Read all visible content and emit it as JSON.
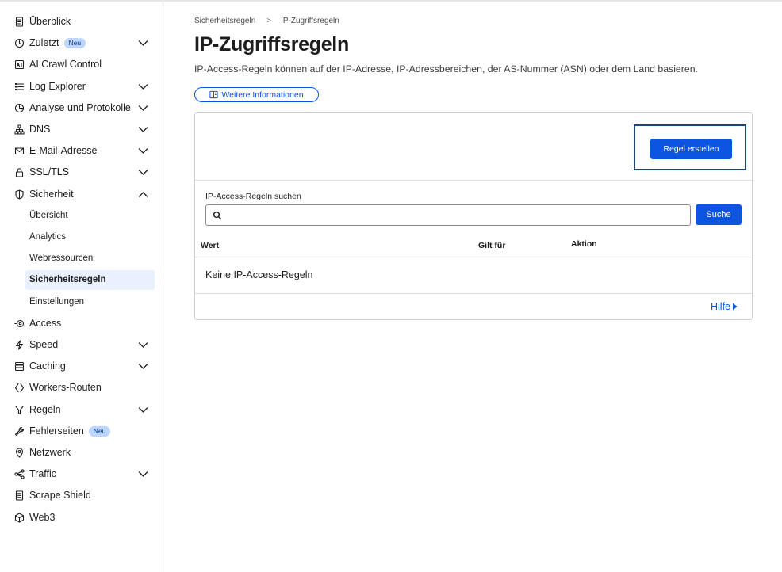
{
  "sidebar": {
    "items": [
      {
        "label": "Überblick",
        "icon": "document-icon",
        "chevron": ""
      },
      {
        "label": "Zuletzt",
        "icon": "clock-icon",
        "badge": "Neu",
        "chevron": "down"
      },
      {
        "label": "AI Crawl Control",
        "icon": "ai-icon",
        "chevron": ""
      },
      {
        "label": "Log Explorer",
        "icon": "list-icon",
        "chevron": "down"
      },
      {
        "label": "Analyse und Protokolle",
        "icon": "pie-chart-icon",
        "chevron": "down"
      },
      {
        "label": "DNS",
        "icon": "network-tree-icon",
        "chevron": "down"
      },
      {
        "label": "E-Mail-Adresse",
        "icon": "mail-icon",
        "chevron": "down"
      },
      {
        "label": "SSL/TLS",
        "icon": "lock-icon",
        "chevron": "down"
      },
      {
        "label": "Sicherheit",
        "icon": "shield-icon",
        "chevron": "up"
      }
    ],
    "sub_items": [
      {
        "label": "Übersicht"
      },
      {
        "label": "Analytics"
      },
      {
        "label": "Webressourcen"
      },
      {
        "label": "Sicherheitsregeln",
        "active": true
      },
      {
        "label": "Einstellungen"
      }
    ],
    "items_after": [
      {
        "label": "Access",
        "icon": "access-icon",
        "chevron": ""
      },
      {
        "label": "Speed",
        "icon": "lightning-icon",
        "chevron": "down"
      },
      {
        "label": "Caching",
        "icon": "server-stack-icon",
        "chevron": "down"
      },
      {
        "label": "Workers-Routen",
        "icon": "workers-icon",
        "chevron": ""
      },
      {
        "label": "Regeln",
        "icon": "funnel-icon",
        "chevron": "down"
      },
      {
        "label": "Fehlerseiten",
        "icon": "wrench-icon",
        "badge": "Neu",
        "chevron": ""
      },
      {
        "label": "Netzwerk",
        "icon": "location-pin-icon",
        "chevron": ""
      },
      {
        "label": "Traffic",
        "icon": "share-nodes-icon",
        "chevron": "down"
      },
      {
        "label": "Scrape Shield",
        "icon": "page-icon",
        "chevron": ""
      },
      {
        "label": "Web3",
        "icon": "cube-icon",
        "chevron": ""
      }
    ]
  },
  "breadcrumb": {
    "parent": "Sicherheitsregeln",
    "separator": ">",
    "current": "IP-Zugriffsregeln"
  },
  "page": {
    "title": "IP-Zugriffsregeln",
    "description": "IP-Access-Regeln können auf der IP-Adresse, IP-Adressbereichen, der AS-Nummer (ASN) oder dem Land basieren.",
    "info_button": "Weitere Informationen"
  },
  "panel": {
    "create_button": "Regel erstellen",
    "search_label": "IP-Access-Regeln suchen",
    "search_value": "",
    "search_button": "Suche",
    "columns": [
      "Wert",
      "Gilt für",
      "Aktion"
    ],
    "empty_text": "Keine IP-Access-Regeln",
    "help_link": "Hilfe"
  },
  "colors": {
    "accent": "#0b55e0",
    "focus_outline": "#1e4478",
    "active_bg": "#e9f1ff",
    "badge_bg": "#bcd6ff"
  }
}
